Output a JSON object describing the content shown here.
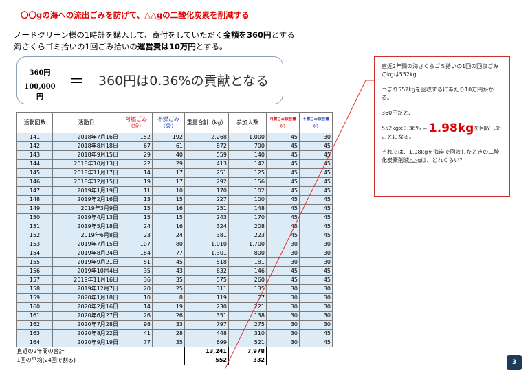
{
  "title": "〇〇gの海への流出ごみを防げて、△△gの二酸化炭素を削減する",
  "intro": {
    "line1_a": "ノードクリーン様の1時計を購入して、寄付をしていただく",
    "line1_b": "金額を360円",
    "line1_c": "とする",
    "line2_a": "海さくらゴミ拾いの1回ごみ拾いの",
    "line2_b": "運営費は10万円",
    "line2_c": "とする。"
  },
  "formula": {
    "numerator": "360円",
    "denominator": "100,000円",
    "equals": "＝",
    "result": "360円は0.36%の貢献となる"
  },
  "table": {
    "headers": {
      "count": "活動回数",
      "date": "活動日",
      "burnable": "可燃ごみ（袋）",
      "nonburnable": "不燃ごみ（袋）",
      "weight": "重量合計（kg）",
      "participants": "参加人数",
      "burn_cap": "可燃ごみ袋容量(ℓ)",
      "nonburn_cap": "不燃ごみ袋容量(ℓ)"
    },
    "rows": [
      [
        "141",
        "2018年7月16日",
        "152",
        "192",
        "2,268",
        "1,000",
        "45",
        "30"
      ],
      [
        "142",
        "2018年8月18日",
        "67",
        "61",
        "872",
        "700",
        "45",
        "45"
      ],
      [
        "143",
        "2018年9月15日",
        "29",
        "40",
        "559",
        "140",
        "45",
        "45"
      ],
      [
        "144",
        "2018年10月13日",
        "22",
        "29",
        "413",
        "142",
        "45",
        "45"
      ],
      [
        "145",
        "2018年11月17日",
        "14",
        "17",
        "251",
        "125",
        "45",
        "45"
      ],
      [
        "146",
        "2018年12月15日",
        "19",
        "17",
        "292",
        "156",
        "45",
        "45"
      ],
      [
        "147",
        "2019年1月19日",
        "11",
        "10",
        "170",
        "102",
        "45",
        "45"
      ],
      [
        "148",
        "2019年2月16日",
        "13",
        "15",
        "227",
        "100",
        "45",
        "45"
      ],
      [
        "149",
        "2019年3月9日",
        "15",
        "16",
        "251",
        "148",
        "45",
        "45"
      ],
      [
        "150",
        "2019年4月13日",
        "15",
        "15",
        "243",
        "170",
        "45",
        "45"
      ],
      [
        "151",
        "2019年5月18日",
        "24",
        "16",
        "324",
        "208",
        "45",
        "45"
      ],
      [
        "152",
        "2019年6月8日",
        "23",
        "24",
        "381",
        "223",
        "45",
        "45"
      ],
      [
        "153",
        "2019年7月15日",
        "107",
        "80",
        "1,010",
        "1,700",
        "30",
        "30"
      ],
      [
        "154",
        "2019年8月24日",
        "164",
        "77",
        "1,301",
        "800",
        "30",
        "30"
      ],
      [
        "155",
        "2019年9月21日",
        "51",
        "45",
        "518",
        "181",
        "30",
        "30"
      ],
      [
        "156",
        "2019年10月4日",
        "35",
        "43",
        "632",
        "146",
        "45",
        "45"
      ],
      [
        "157",
        "2019年11月16日",
        "36",
        "35",
        "575",
        "260",
        "45",
        "45"
      ],
      [
        "158",
        "2019年12月7日",
        "20",
        "25",
        "311",
        "135",
        "30",
        "30"
      ],
      [
        "159",
        "2020年1月18日",
        "10",
        "8",
        "119",
        "77",
        "30",
        "30"
      ],
      [
        "160",
        "2020年2月16日",
        "14",
        "19",
        "230",
        "221",
        "30",
        "30"
      ],
      [
        "161",
        "2020年6月27日",
        "26",
        "26",
        "351",
        "138",
        "30",
        "30"
      ],
      [
        "162",
        "2020年7月28日",
        "98",
        "33",
        "797",
        "275",
        "30",
        "30"
      ],
      [
        "163",
        "2020年8月22日",
        "41",
        "28",
        "448",
        "310",
        "30",
        "45"
      ],
      [
        "164",
        "2020年9月19日",
        "77",
        "35",
        "699",
        "521",
        "30",
        "45"
      ]
    ],
    "footer": {
      "total_label": "直近の2年間の合計",
      "total_weight": "13,241",
      "total_participants": "7,978",
      "avg_label": "1回の平均(24回で割る)",
      "avg_weight": "552",
      "avg_participants": "332"
    }
  },
  "note": {
    "p1": "直近2年間の海さくらゴミ拾いの1回の回収ごみのkgは552kg",
    "p2": "つまり552kgを回収するにあたり10万円かかる。",
    "p3": "360円だと、",
    "p4_a": "552kg×0.36% =",
    "p4_big": "1.98kg",
    "p4_b": "を回収したことになる。",
    "p5": "それでは、1.98kgを海岸で回収したときの二酸化炭素削減△△gは、どれくらい？"
  },
  "page_number": "3",
  "colors": {
    "title_red": "#e00000",
    "table_fill": "#ddebf7",
    "badge": "#1f3b5c",
    "arrow": "#e03030"
  }
}
